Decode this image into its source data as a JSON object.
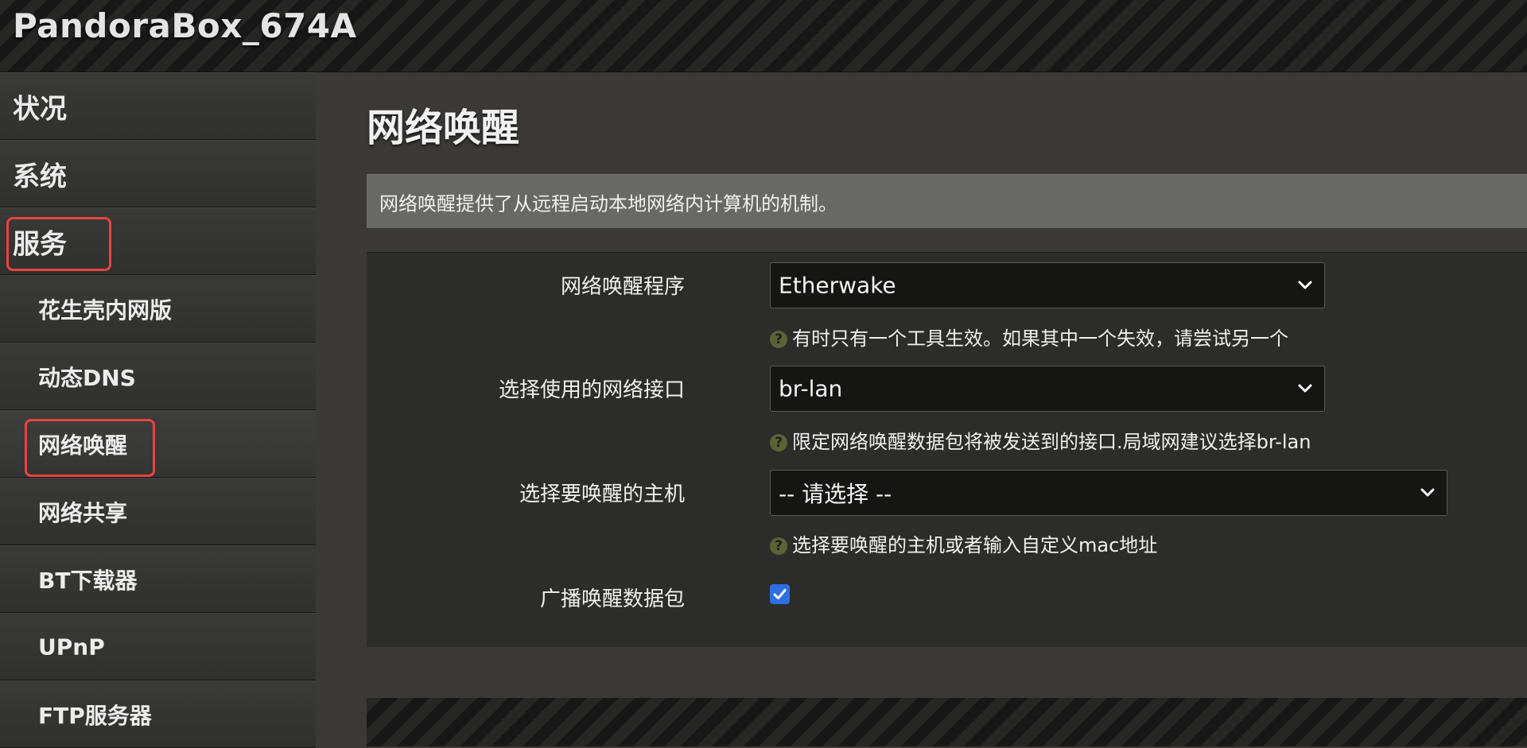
{
  "header": {
    "brand": "PandoraBox_674A"
  },
  "sidebar": {
    "items": [
      {
        "label": "状况"
      },
      {
        "label": "系统"
      },
      {
        "label": "服务"
      },
      {
        "label": "花生壳内网版"
      },
      {
        "label": "动态DNS"
      },
      {
        "label": "网络唤醒"
      },
      {
        "label": "网络共享"
      },
      {
        "label": "BT下载器"
      },
      {
        "label": "UPnP"
      },
      {
        "label": "FTP服务器"
      }
    ]
  },
  "main": {
    "title": "网络唤醒",
    "description": "网络唤醒提供了从远程启动本地网络内计算机的机制。",
    "form": {
      "program": {
        "label": "网络唤醒程序",
        "value": "Etherwake",
        "hint": "有时只有一个工具生效。如果其中一个失效，请尝试另一个"
      },
      "interface": {
        "label": "选择使用的网络接口",
        "value": "br-lan",
        "hint": "限定网络唤醒数据包将被发送到的接口.局域网建议选择br-lan"
      },
      "host": {
        "label": "选择要唤醒的主机",
        "value": "-- 请选择 --",
        "hint": "选择要唤醒的主机或者输入自定义mac地址"
      },
      "broadcast": {
        "label": "广播唤醒数据包",
        "checked": true
      }
    }
  },
  "icons": {
    "hint": "help-icon",
    "select": "chevron-down-icon",
    "checkbox": "checkmark-icon"
  },
  "colors": {
    "highlight": "#e8433f",
    "checkbox": "#2f6fe0",
    "hint_icon": "#5b6334"
  }
}
